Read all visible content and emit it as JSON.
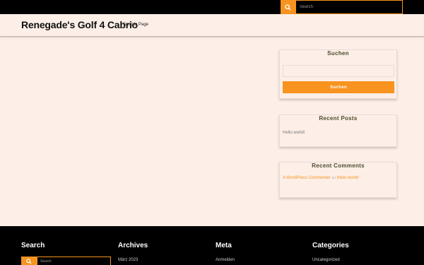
{
  "top_search": {
    "placeholder": "Search",
    "icon": "search-icon"
  },
  "header": {
    "site_title": "Renegade's Golf 4 Cabrio",
    "nav": [
      "Sample Page"
    ]
  },
  "sidebar": {
    "search": {
      "title": "Suchen",
      "button_label": "Suchen",
      "value": ""
    },
    "recent_posts": {
      "title": "Recent Posts",
      "items": [
        "Hello world!"
      ]
    },
    "recent_comments": {
      "title": "Recent Comments",
      "items": [
        {
          "author": "A WordPress Commenter",
          "connector": "zu",
          "post": "Hello world!"
        }
      ]
    }
  },
  "footer": {
    "search": {
      "title": "Search",
      "placeholder": "Search"
    },
    "archives": {
      "title": "Archives",
      "items": [
        "März 2023"
      ]
    },
    "meta": {
      "title": "Meta",
      "items": [
        "Anmelden"
      ]
    },
    "categories": {
      "title": "Categories",
      "items": [
        "Uncategorized"
      ]
    }
  },
  "colors": {
    "accent": "#f7931e",
    "background": "#fdefe8",
    "dark": "#000000"
  }
}
